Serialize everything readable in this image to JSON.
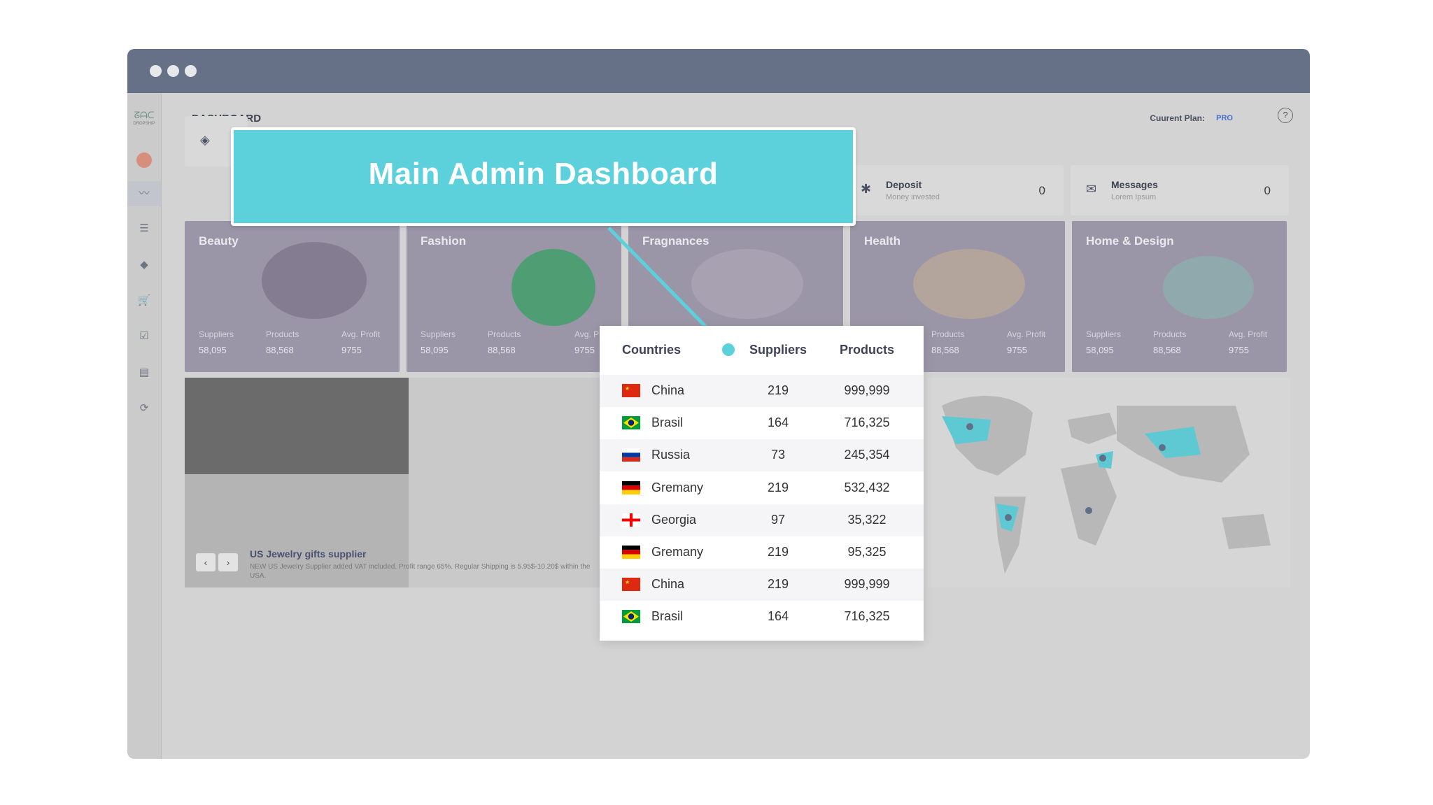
{
  "window": {
    "dots": 3
  },
  "sidebar": {
    "logo_text": "ᘔᗩᑕ",
    "logo_sub": "DROPSHIP"
  },
  "header": {
    "title": "DASHBOARD",
    "plan_label": "Cuurent Plan:",
    "plan_value": "PRO",
    "help_icon": "?"
  },
  "stats": [
    {
      "icon": "cube-icon",
      "title": "",
      "subtitle": "",
      "value": ""
    },
    {
      "icon": "star-icon",
      "title": "Deposit",
      "subtitle": "Money invested",
      "value": "0"
    },
    {
      "icon": "envelope-icon",
      "title": "Messages",
      "subtitle": "Lorem Ipsum",
      "value": "0"
    }
  ],
  "categories": [
    {
      "name": "Beauty",
      "suppliers_label": "Suppliers",
      "suppliers": "58,095",
      "products_label": "Products",
      "products": "88,568",
      "profit_label": "Avg. Profit",
      "profit": "9755"
    },
    {
      "name": "Fashion",
      "suppliers_label": "Suppliers",
      "suppliers": "58,095",
      "products_label": "Products",
      "products": "88,568",
      "profit_label": "Avg. Prof",
      "profit": "9755"
    },
    {
      "name": "Fragnances",
      "suppliers_label": "",
      "suppliers": "",
      "products_label": "",
      "products": "",
      "profit_label": "",
      "profit": ""
    },
    {
      "name": "Health",
      "suppliers_label": "",
      "suppliers": "",
      "products_label": "Products",
      "products": "88,568",
      "profit_label": "Avg. Profit",
      "profit": "9755"
    },
    {
      "name": "Home & Design",
      "suppliers_label": "Suppliers",
      "suppliers": "58,095",
      "products_label": "Products",
      "products": "88,568",
      "profit_label": "Avg. Profit",
      "profit": "9755"
    }
  ],
  "banner": {
    "title": "US Jewelry gifts supplier",
    "description": "NEW US Jewelry Supplier added VAT included. Profit range 65%. Regular Shipping is 5.95$-10.20$ within the USA.",
    "prev": "‹",
    "next": "›"
  },
  "callout": {
    "title": "Main Admin Dashboard"
  },
  "table": {
    "headers": {
      "countries": "Countries",
      "suppliers": "Suppliers",
      "products": "Products"
    },
    "rows": [
      {
        "country": "China",
        "flag": "china",
        "suppliers": "219",
        "products": "999,999"
      },
      {
        "country": "Brasil",
        "flag": "brasil",
        "suppliers": "164",
        "products": "716,325"
      },
      {
        "country": "Russia",
        "flag": "russia",
        "suppliers": "73",
        "products": "245,354"
      },
      {
        "country": "Gremany",
        "flag": "germany",
        "suppliers": "219",
        "products": "532,432"
      },
      {
        "country": "Georgia",
        "flag": "georgia",
        "suppliers": "97",
        "products": "35,322"
      },
      {
        "country": "Gremany",
        "flag": "germany",
        "suppliers": "219",
        "products": "95,325"
      },
      {
        "country": "China",
        "flag": "china",
        "suppliers": "219",
        "products": "999,999"
      },
      {
        "country": "Brasil",
        "flag": "brasil",
        "suppliers": "164",
        "products": "716,325"
      }
    ]
  },
  "colors": {
    "accent": "#5cd1dc",
    "titlebar": "#667087",
    "plan": "#4a6dd1"
  }
}
